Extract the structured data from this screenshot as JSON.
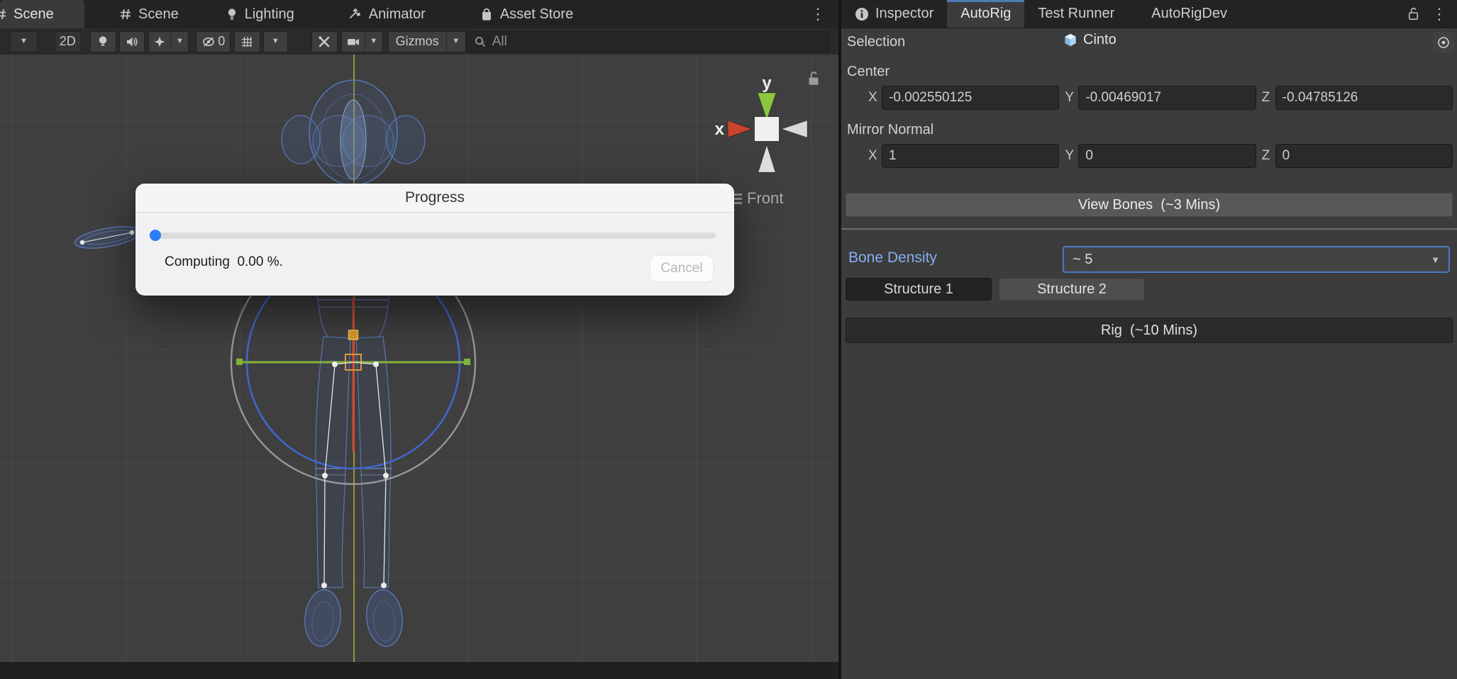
{
  "icons": {
    "chevron_down": "▼",
    "dots_vertical": "⋮"
  },
  "left_tabs": {
    "scene1": "Scene",
    "scene2": "Scene",
    "lighting": "Lighting",
    "animator": "Animator",
    "asset_store": "Asset Store"
  },
  "toolbar": {
    "mode_2d": "2D",
    "hidden_count": "0",
    "gizmos_label": "Gizmos",
    "search_placeholder": "All"
  },
  "viewport": {
    "axis_x_label": "x",
    "axis_y_label": "y",
    "view_orientation_label": "Front"
  },
  "dialog": {
    "title": "Progress",
    "status_text": "Computing  0.00 %.",
    "cancel_label": "Cancel",
    "progress_percent": 0
  },
  "right_tabs": {
    "inspector": "Inspector",
    "autorig": "AutoRig",
    "test_runner": "Test Runner",
    "autorigdev": "AutoRigDev"
  },
  "autorig": {
    "selection_label": "Selection",
    "selection_object": "Cinto",
    "center_label": "Center",
    "center_x_label": "X",
    "center_x": "-0.002550125",
    "center_y_label": "Y",
    "center_y": "-0.00469017",
    "center_z_label": "Z",
    "center_z": "-0.04785126",
    "mirror_label": "Mirror Normal",
    "mirror_x_label": "X",
    "mirror_x": "1",
    "mirror_y_label": "Y",
    "mirror_y": "0",
    "mirror_z_label": "Z",
    "mirror_z": "0",
    "view_bones_label": "View Bones  (~3 Mins)",
    "bone_density_label": "Bone Density",
    "bone_density_value": "~ 5",
    "structure1_label": "Structure 1",
    "structure2_label": "Structure 2",
    "rig_label": "Rig  (~10 Mins)"
  },
  "colors": {
    "autorig_tab_accent": "#4c7baf",
    "bone_density_text": "#84aef2",
    "dropdown_border": "#4a7ac8",
    "progress_accent": "#2e7bf6"
  }
}
